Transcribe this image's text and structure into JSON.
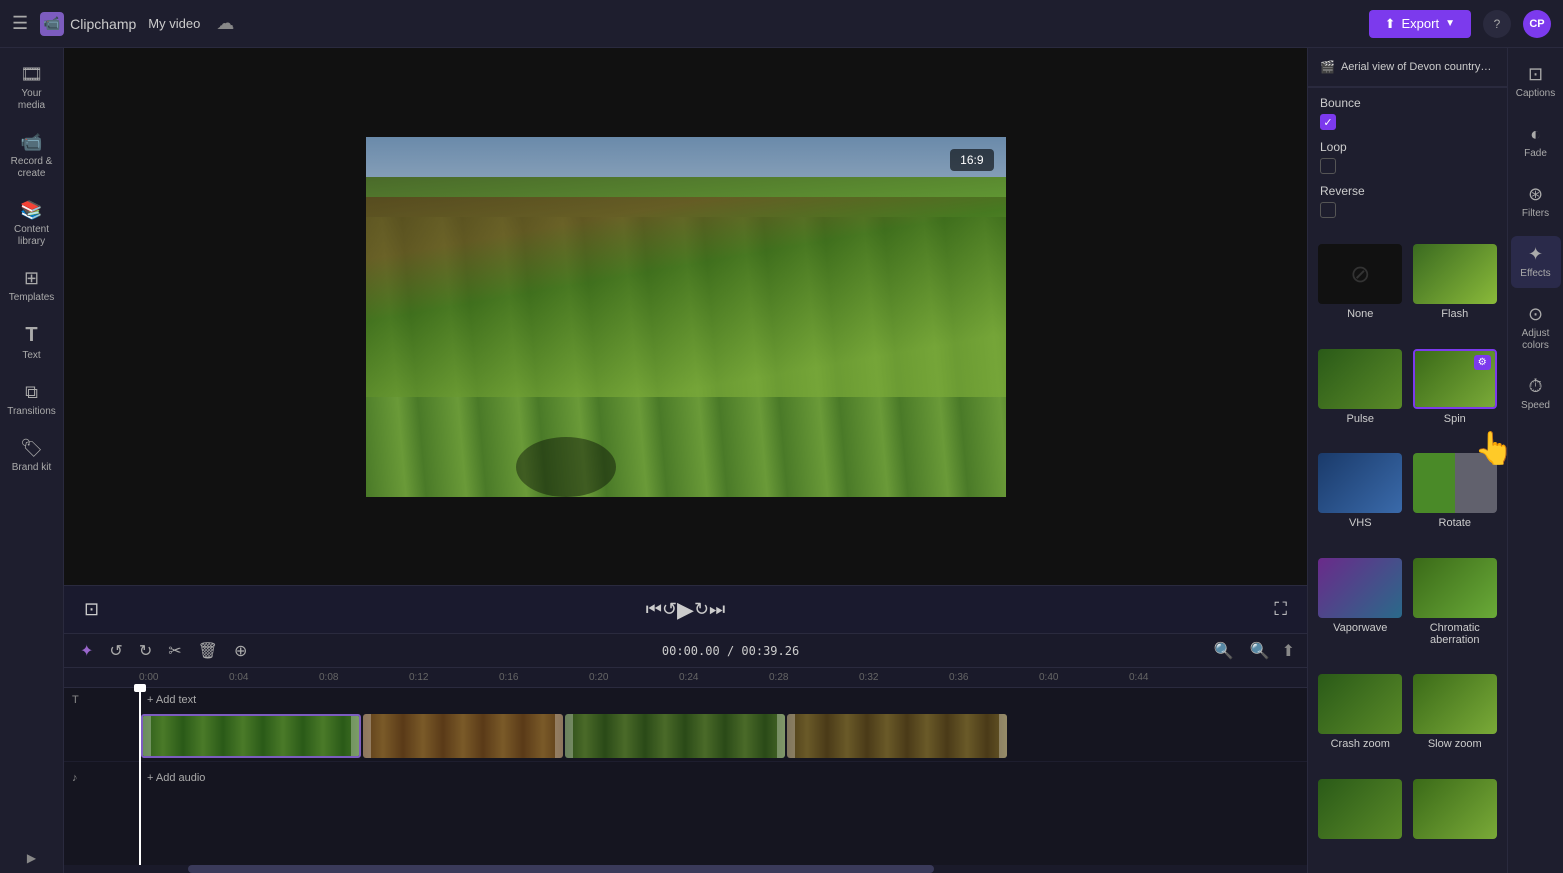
{
  "app": {
    "name": "Clipchamp",
    "title": "My video"
  },
  "topbar": {
    "export_label": "Export",
    "help_icon": "?",
    "avatar_initials": "CP"
  },
  "left_sidebar": {
    "items": [
      {
        "id": "your-media",
        "label": "Your media",
        "icon": "🎞"
      },
      {
        "id": "record-create",
        "label": "Record & create",
        "icon": "📹"
      },
      {
        "id": "content-library",
        "label": "Content library",
        "icon": "📚"
      },
      {
        "id": "templates",
        "label": "Templates",
        "icon": "⊞"
      },
      {
        "id": "text",
        "label": "Text",
        "icon": "T"
      },
      {
        "id": "transitions",
        "label": "Transitions",
        "icon": "⧉"
      },
      {
        "id": "brand-kit",
        "label": "Brand kit",
        "icon": "🏷"
      }
    ]
  },
  "preview": {
    "aspect_ratio": "16:9",
    "video_title": "Aerial view of Devon countryside"
  },
  "timeline": {
    "current_time": "00:00.00",
    "total_time": "00:39.26",
    "add_text_label": "+ Add text",
    "add_audio_label": "+ Add audio",
    "ruler_marks": [
      "0:00",
      "0:04",
      "0:08",
      "0:12",
      "0:16",
      "0:20",
      "0:24",
      "0:28",
      "0:32",
      "0:36",
      "0:40",
      "0:44"
    ]
  },
  "effects_panel": {
    "header": "Aerial view of Devon countryside",
    "items": [
      {
        "id": "none",
        "label": "None",
        "type": "none"
      },
      {
        "id": "flash",
        "label": "Flash",
        "type": "flash"
      },
      {
        "id": "pulse",
        "label": "Pulse",
        "type": "pulse"
      },
      {
        "id": "spin",
        "label": "Spin",
        "type": "spin",
        "selected": true
      },
      {
        "id": "vhs",
        "label": "VHS",
        "type": "vhs"
      },
      {
        "id": "rotate",
        "label": "Rotate",
        "type": "rotate"
      },
      {
        "id": "vaporwave",
        "label": "Vaporwave",
        "type": "vaporwave"
      },
      {
        "id": "chromatic",
        "label": "Chromatic aberration",
        "type": "chromatic"
      },
      {
        "id": "crashzoom",
        "label": "Crash zoom",
        "type": "crashzoom"
      },
      {
        "id": "slowzoom",
        "label": "Slow zoom",
        "type": "slowzoom"
      },
      {
        "id": "more1",
        "label": "",
        "type": "more1"
      },
      {
        "id": "more2",
        "label": "",
        "type": "more2"
      }
    ]
  },
  "bounce_loop": {
    "bounce_label": "Bounce",
    "bounce_checked": true,
    "loop_label": "Loop",
    "loop_checked": false,
    "reverse_label": "Reverse",
    "reverse_checked": false
  },
  "far_right": {
    "items": [
      {
        "id": "captions",
        "label": "Captions",
        "icon": "⊡"
      },
      {
        "id": "fade",
        "label": "Fade",
        "icon": "◐"
      },
      {
        "id": "filters",
        "label": "Filters",
        "icon": "⊛"
      },
      {
        "id": "effects",
        "label": "Effects",
        "icon": "✦"
      },
      {
        "id": "adjust-colors",
        "label": "Adjust colors",
        "icon": "⊙"
      },
      {
        "id": "speed",
        "label": "Speed",
        "icon": "⏱"
      }
    ]
  }
}
